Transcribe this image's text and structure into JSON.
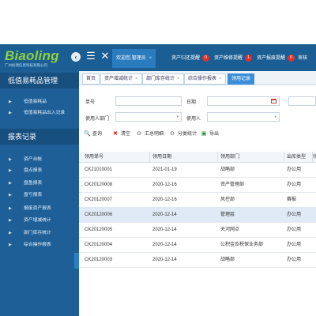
{
  "header": {
    "logo_text": "Biaoling",
    "logo_sub": "广州标领信息科技有限公司",
    "back_glyph": "‹",
    "menu_glyph": "☰",
    "close_glyph": "✕",
    "tabs": [
      {
        "label": "欢迎您,管理员",
        "close": "×",
        "badge": ""
      },
      {
        "label": "资产归还提醒",
        "close": "",
        "badge": "0"
      },
      {
        "label": "资产维修提醒",
        "close": "",
        "badge": "1"
      },
      {
        "label": "资产报废提醒",
        "close": "",
        "badge": "0"
      },
      {
        "label": "审核",
        "close": "",
        "badge": ""
      }
    ]
  },
  "sidebar": {
    "section1": "低值易耗品管理",
    "section1_items": [
      "低值易耗品",
      "低值易耗品出入记录"
    ],
    "section2": "报表记录",
    "section2_items": [
      "资产台帐",
      "盘点报表",
      "盘盈报表",
      "盘亏报表",
      "报废资产报表",
      "资产增减统计",
      "部门库存统计",
      "综合操作报表"
    ],
    "arrow": "▶"
  },
  "page_tabs": [
    {
      "label": "首页",
      "close": ""
    },
    {
      "label": "资产增减统计",
      "close": "×"
    },
    {
      "label": "部门库存统计",
      "close": "×"
    },
    {
      "label": "综合操作报表",
      "close": "×"
    },
    {
      "label": "领用记录",
      "close": ""
    }
  ],
  "form": {
    "order_no_label": "单号",
    "order_no_value": "",
    "date_label": "日期",
    "date_value": "",
    "date_sep": "-",
    "dept_label": "使用人部门",
    "dept_value": "",
    "user_label": "使用人",
    "user_value": "",
    "select_arrow": "▾"
  },
  "toolbar": [
    {
      "icon": "🔍",
      "label": "查询",
      "color": "#2a6db0"
    },
    {
      "icon": "✖",
      "label": "清空",
      "color": "#d0342c"
    },
    {
      "icon": "⊙",
      "label": "汇总明细",
      "color": "#555555"
    },
    {
      "icon": "⊙",
      "label": "分类统计",
      "color": "#555555"
    },
    {
      "icon": "▣",
      "label": "导出",
      "color": "#2e8b3a"
    }
  ],
  "table": {
    "columns": [
      "领用单号",
      "领用日期",
      "领用部门",
      "出库类型",
      "领"
    ],
    "rows": [
      [
        "CK21010001",
        "2021-01-19",
        "战略部",
        "办公用"
      ],
      [
        "CK20120008",
        "2020-12-16",
        "资产管理部",
        "办公用"
      ],
      [
        "CK20120007",
        "2020-12-16",
        "风控部",
        "赛报"
      ],
      [
        "CK20120006",
        "2020-12-14",
        "管理层",
        "办公用"
      ],
      [
        "CK20120005",
        "2020-12-14",
        "天河网点",
        "办公用"
      ],
      [
        "CK20120004",
        "2020-12-14",
        "公积金及税保业务部",
        "办公用"
      ],
      [
        "CK20120003",
        "2020-12-14",
        "战略部",
        "办公用"
      ]
    ],
    "highlight_row": 3
  }
}
